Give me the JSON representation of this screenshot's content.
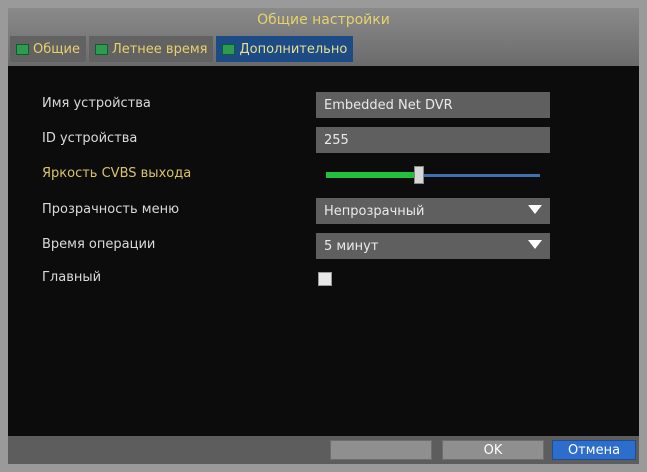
{
  "window": {
    "title": "Общие настройки"
  },
  "tabs": [
    {
      "label": "Общие",
      "active": false
    },
    {
      "label": "Летнее время",
      "active": false
    },
    {
      "label": "Дополнительно",
      "active": true
    }
  ],
  "settings": {
    "device_name_label": "Имя устройства",
    "device_name_value": "Embedded Net DVR",
    "device_id_label": "ID устройства",
    "device_id_value": "255",
    "cvbs_brightness_label": "Яркость CVBS выхода",
    "cvbs_brightness_level": 0.43,
    "menu_transparency_label": "Прозрачность меню",
    "menu_transparency_value": "Непрозрачный",
    "operation_time_label": "Время операции",
    "operation_time_value": "5 минут",
    "main_label": "Главный",
    "main_checked": false
  },
  "footer": {
    "apply_label": "",
    "ok_label": "OK",
    "cancel_label": "Отмена"
  },
  "colors": {
    "title_text": "#e6d36a",
    "active_tab": "#1c4b86",
    "slider_fill": "#23c040",
    "slider_track": "#4070b0",
    "cancel_button": "#2d6ecc"
  },
  "icons": {
    "tab_icon": "green-monitor-icon",
    "dropdown_icon": "triangle-down-icon"
  }
}
